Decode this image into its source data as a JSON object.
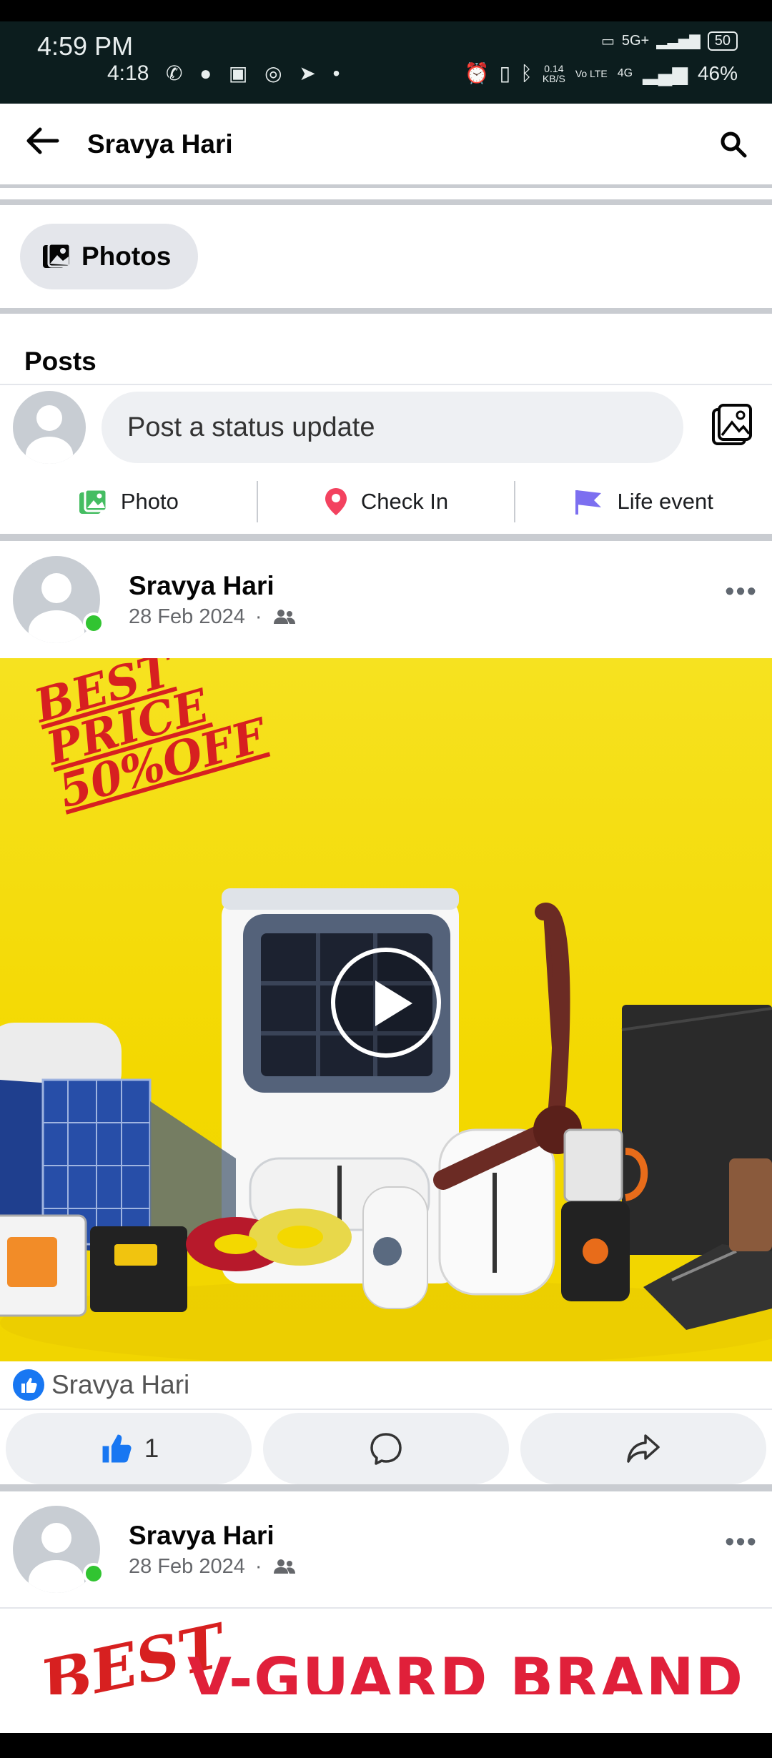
{
  "status_bar": {
    "time_primary": "4:59 PM",
    "time_secondary": "4:18",
    "app_icons": [
      "whatsapp-icon",
      "chat-icon",
      "message-icon",
      "instagram-icon",
      "telegram-icon"
    ],
    "network_top": "5G+",
    "battery_top": "50",
    "speed": "0.14",
    "speed_unit": "KB/S",
    "net_label": "Vo LTE",
    "network_bottom": "4G",
    "battery_percent": "46%"
  },
  "header": {
    "title": "Sravya Hari"
  },
  "photos_button": {
    "label": "Photos"
  },
  "posts_section": {
    "heading": "Posts"
  },
  "composer": {
    "placeholder": "Post a status update",
    "actions": [
      {
        "label": "Photo",
        "icon": "photo-icon",
        "color": "#45bd62"
      },
      {
        "label": "Check In",
        "icon": "location-pin-icon",
        "color": "#f3425f"
      },
      {
        "label": "Life event",
        "icon": "flag-icon",
        "color": "#7c6ff0"
      }
    ]
  },
  "posts": [
    {
      "author": "Sravya Hari",
      "date": "28 Feb 2024",
      "audience_icon": "friends-icon",
      "promo_lines": [
        "BEST",
        "PRICE",
        "50%OFF"
      ],
      "liked_by": "Sravya Hari",
      "like_count": "1"
    },
    {
      "author": "Sravya Hari",
      "date": "28 Feb 2024",
      "audience_icon": "friends-icon",
      "media_text_1": "BEST",
      "media_text_2": "V-GUARD BRAND"
    }
  ],
  "colors": {
    "accent": "#1877f2",
    "online": "#31c431",
    "divider": "#c9ccd1",
    "media_bg": "#f3d800"
  }
}
